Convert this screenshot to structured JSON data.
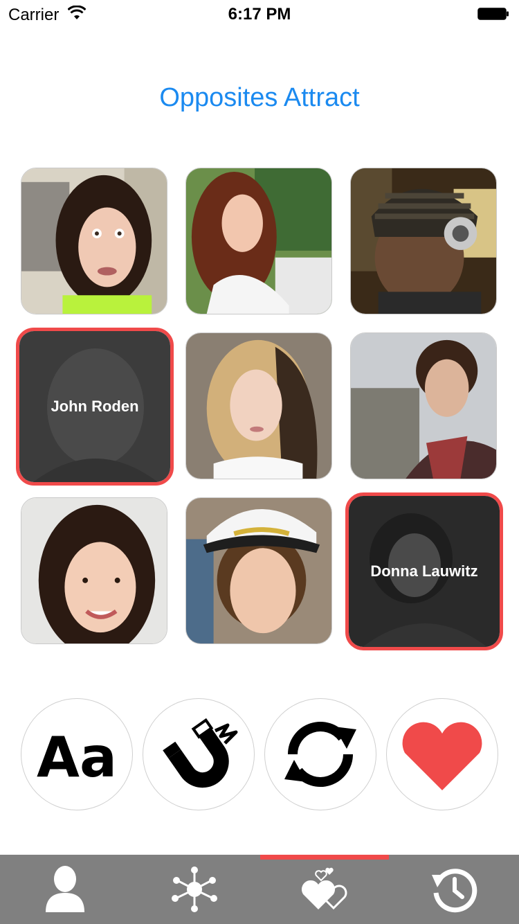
{
  "status_bar": {
    "carrier": "Carrier",
    "time": "6:17 PM"
  },
  "header": {
    "title": "Opposites Attract"
  },
  "grid": {
    "tiles": [
      {
        "name": "",
        "selected": false
      },
      {
        "name": "",
        "selected": false
      },
      {
        "name": "",
        "selected": false
      },
      {
        "name": "John Roden",
        "selected": true
      },
      {
        "name": "",
        "selected": false
      },
      {
        "name": "",
        "selected": false
      },
      {
        "name": "",
        "selected": false
      },
      {
        "name": "",
        "selected": false
      },
      {
        "name": "Donna Lauwitz",
        "selected": true
      }
    ]
  },
  "actions": [
    {
      "icon": "font-icon",
      "label": "Aa"
    },
    {
      "icon": "magnet-icon"
    },
    {
      "icon": "refresh-icon"
    },
    {
      "icon": "heart-icon"
    }
  ],
  "tabbar": {
    "active_index": 2,
    "tabs": [
      {
        "icon": "person-icon"
      },
      {
        "icon": "network-icon"
      },
      {
        "icon": "hearts-icon"
      },
      {
        "icon": "history-icon"
      }
    ]
  },
  "colors": {
    "accent": "#f04a4a",
    "title": "#1b8af0",
    "tabbar": "#808080"
  }
}
